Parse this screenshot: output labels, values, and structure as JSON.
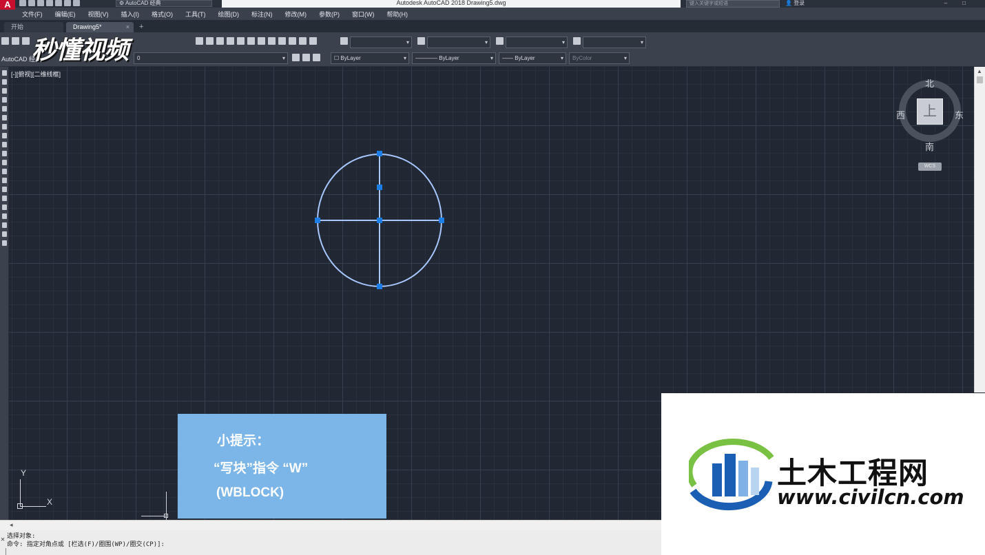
{
  "titlebar": {
    "app_letter": "A",
    "workspace": "AutoCAD 经典",
    "title": "Autodesk AutoCAD 2018    Drawing5.dwg",
    "search_placeholder": "键入关键字或短语",
    "login": "登录"
  },
  "menu": [
    "文件(F)",
    "编辑(E)",
    "视图(V)",
    "插入(I)",
    "格式(O)",
    "工具(T)",
    "绘图(D)",
    "标注(N)",
    "修改(M)",
    "参数(P)",
    "窗口(W)",
    "帮助(H)"
  ],
  "tabs": {
    "start": "开始",
    "drawing": "Drawing5*",
    "close": "×",
    "add": "+"
  },
  "toolbar": {
    "workspace_label": "AutoCAD 经典",
    "layer_value": "0",
    "color": "ByLayer",
    "linetype": "ByLayer",
    "lineweight": "ByLayer",
    "plotstyle": "ByColor"
  },
  "watermark_top": "秒懂视频",
  "viewport_label": "[-][俯视][二维线框]",
  "viewcube": {
    "n": "北",
    "s": "南",
    "w": "西",
    "e": "东",
    "face": "上",
    "wcs": "WCS"
  },
  "ucs": {
    "x": "X",
    "y": "Y"
  },
  "tip": {
    "line1": "小提示：",
    "line2": "“写块”指令  “W”",
    "line3": "(WBLOCK)"
  },
  "command": {
    "line1": "选择对象:",
    "line2": "命令: 指定对角点或 [栏选(F)/圈围(WP)/圈交(CP)]:"
  },
  "logo": {
    "cn": "土木工程网",
    "en": "www.civilcn.com"
  },
  "colors": {
    "canvas": "#212833",
    "entity": "#a8c8ff",
    "grip": "#1e7ee8",
    "tip_bg": "#7cb6e8"
  }
}
